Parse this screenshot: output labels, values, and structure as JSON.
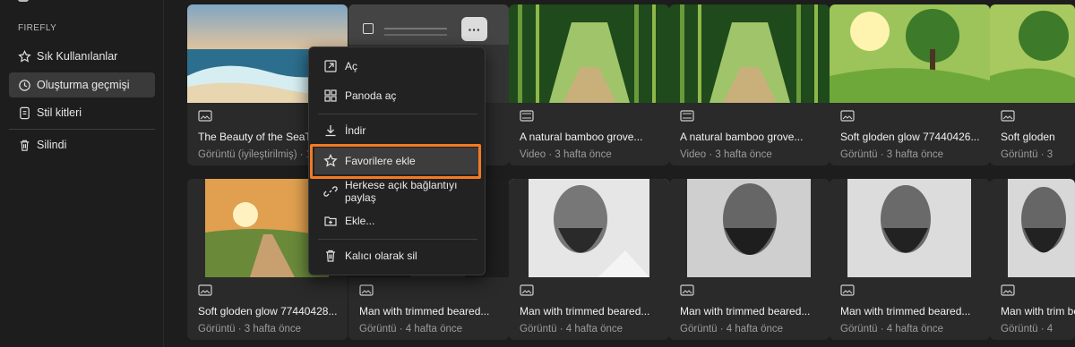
{
  "sidebar": {
    "section_label": "FIREFLY",
    "items": [
      {
        "label": "Sık Kullanılanlar",
        "icon": "star-icon"
      },
      {
        "label": "Oluşturma geçmişi",
        "icon": "history-icon"
      },
      {
        "label": "Stil kitleri",
        "icon": "style-kit-icon"
      },
      {
        "label": "Silindi",
        "icon": "trash-icon"
      }
    ]
  },
  "cards_row1": [
    {
      "title": "The Beauty of the SeaThe...",
      "meta": "Görüntü (iyileştirilmiş) · 1...",
      "type": "image-icon"
    },
    {
      "title": "",
      "meta": "",
      "type": "image-icon"
    },
    {
      "title": "A natural bamboo grove...",
      "meta": "Video · 3 hafta önce",
      "type": "video-icon"
    },
    {
      "title": "A natural bamboo grove...",
      "meta": "Video · 3 hafta önce",
      "type": "video-icon"
    },
    {
      "title": "Soft gloden glow 77440426...",
      "meta": "Görüntü · 3 hafta önce",
      "type": "image-icon"
    },
    {
      "title": "Soft gloden",
      "meta": "Görüntü · 3",
      "type": "image-icon"
    }
  ],
  "cards_row2": [
    {
      "title": "Soft gloden glow 77440428...",
      "meta": "Görüntü · 3 hafta önce",
      "type": "image-icon"
    },
    {
      "title": "Man with trimmed beared...",
      "meta": "Görüntü · 4 hafta önce",
      "type": "image-icon"
    },
    {
      "title": "Man with trimmed beared...",
      "meta": "Görüntü · 4 hafta önce",
      "type": "image-icon"
    },
    {
      "title": "Man with trimmed beared...",
      "meta": "Görüntü · 4 hafta önce",
      "type": "image-icon"
    },
    {
      "title": "Man with trimmed beared...",
      "meta": "Görüntü · 4 hafta önce",
      "type": "image-icon"
    },
    {
      "title": "Man with trim be",
      "meta": "Görüntü · 4",
      "type": "image-icon"
    }
  ],
  "context_menu": {
    "more_label": "···",
    "items": [
      {
        "label": "Aç",
        "icon": "open-icon"
      },
      {
        "label": "Panoda aç",
        "icon": "board-icon"
      },
      {
        "label": "İndir",
        "icon": "download-icon"
      },
      {
        "label": "Favorilere ekle",
        "icon": "star-icon"
      },
      {
        "label": "Herkese açık bağlantıyı paylaş",
        "icon": "link-icon"
      },
      {
        "label": "Ekle...",
        "icon": "add-to-folder-icon"
      },
      {
        "label": "Kalıcı olarak sil",
        "icon": "trash-icon"
      }
    ]
  },
  "colors": {
    "highlight": "#f27a24",
    "background": "#1d1d1d",
    "card": "#2a2a2a"
  }
}
